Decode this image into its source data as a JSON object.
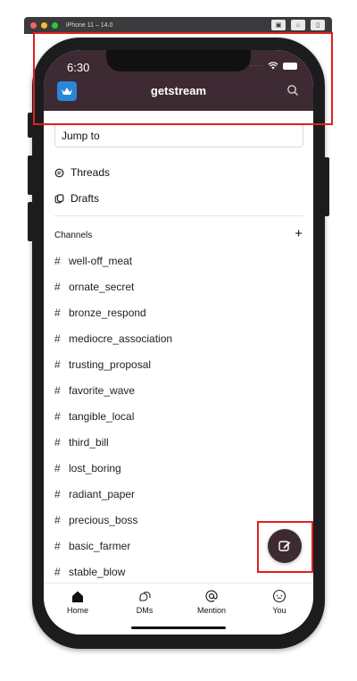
{
  "simulator": {
    "title": "iPhone 11 – 14.0"
  },
  "status_bar": {
    "time": "6:30"
  },
  "header": {
    "title": "getstream"
  },
  "jump_to": {
    "label": "Jump to"
  },
  "nav": {
    "threads": "Threads",
    "drafts": "Drafts"
  },
  "channels": {
    "heading": "Channels",
    "items": [
      "well-off_meat",
      "ornate_secret",
      "bronze_respond",
      "mediocre_association",
      "trusting_proposal",
      "favorite_wave",
      "tangible_local",
      "third_bill",
      "lost_boring",
      "radiant_paper",
      "precious_boss",
      "basic_farmer",
      "stable_blow"
    ]
  },
  "tabs": [
    {
      "label": "Home",
      "icon": "home-icon"
    },
    {
      "label": "DMs",
      "icon": "dms-icon"
    },
    {
      "label": "Mention",
      "icon": "at-icon"
    },
    {
      "label": "You",
      "icon": "face-icon"
    }
  ],
  "colors": {
    "header": "#3e2a33",
    "logo": "#2a86d8",
    "highlight": "#e02020"
  }
}
